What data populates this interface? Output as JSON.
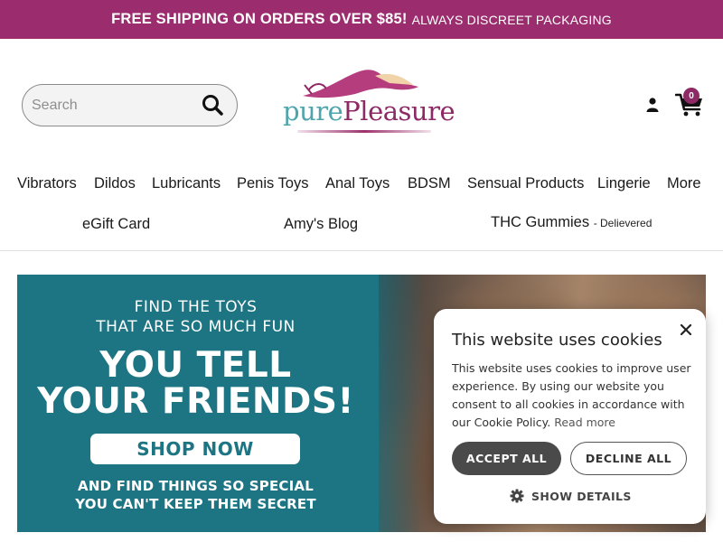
{
  "promo_bar": {
    "main": "FREE SHIPPING ON ORDERS OVER $85!",
    "sub": "ALWAYS DISCREET PACKAGING",
    "color": "#9b2c6e"
  },
  "search": {
    "placeholder": "Search",
    "icon": "search-icon"
  },
  "logo": {
    "part1": "pure",
    "part2": "Pleasure"
  },
  "header_icons": {
    "account": "user-icon",
    "cart": "shopping-cart-icon",
    "cart_count": "0"
  },
  "nav": {
    "row1": [
      "Vibrators",
      "Dildos",
      "Lubricants",
      "Penis Toys",
      "Anal Toys",
      "BDSM",
      "Sensual Products",
      "Lingerie",
      "More"
    ],
    "row2": {
      "egift": "eGift Card",
      "blog": "Amy's Blog",
      "thc": "THC Gummies",
      "thc_note": "- Delievered"
    }
  },
  "hero": {
    "line1": "FIND THE TOYS",
    "line2": "THAT ARE SO MUCH FUN",
    "line3": "YOU TELL",
    "line4": "YOUR FRIENDS!",
    "cta": "SHOP NOW",
    "line5": "AND FIND THINGS SO SPECIAL",
    "line6": "YOU CAN'T KEEP THEM SECRET",
    "bg_color": "#1d7584"
  },
  "cookie_banner": {
    "title": "This website uses cookies",
    "body": "This website uses cookies to improve user experience. By using our website you consent to all cookies in accordance with our Cookie Policy.",
    "read_more": "Read more",
    "accept": "ACCEPT ALL",
    "decline": "DECLINE ALL",
    "show_details": "SHOW DETAILS",
    "close_icon": "close-icon",
    "details_icon": "gear-icon"
  }
}
